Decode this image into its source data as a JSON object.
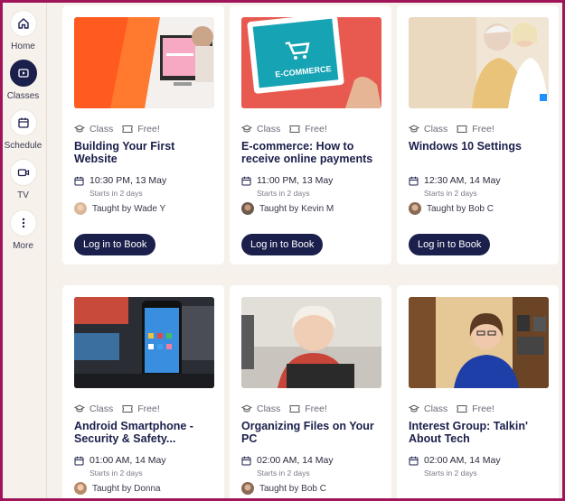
{
  "sidebar": {
    "items": [
      {
        "label": "Home",
        "icon": "home-icon",
        "active": false
      },
      {
        "label": "Classes",
        "icon": "play-icon",
        "active": true
      },
      {
        "label": "Schedule",
        "icon": "calendar-icon",
        "active": false
      },
      {
        "label": "TV",
        "icon": "video-camera-icon",
        "active": false
      },
      {
        "label": "More",
        "icon": "more-vertical-icon",
        "active": false
      }
    ]
  },
  "labels": {
    "class": "Class",
    "free": "Free!",
    "book": "Log in to Book",
    "starts": "Starts in 2 days"
  },
  "cards": [
    {
      "title": "Building Your First Website",
      "datetime": "10:30 PM, 13 May",
      "starts": "Starts in 2 days",
      "teacher": "Taught by Wade Y"
    },
    {
      "title": "E-commerce: How to receive online payments",
      "datetime": "11:00 PM, 13 May",
      "starts": "Starts in 2 days",
      "teacher": "Taught by Kevin M",
      "thumb_text": "E-COMMERCE"
    },
    {
      "title": "Windows 10 Settings",
      "datetime": "12:30 AM, 14 May",
      "starts": "Starts in 2 days",
      "teacher": "Taught by Bob C"
    },
    {
      "title": "Android Smartphone - Security & Safety...",
      "datetime": "01:00 AM, 14 May",
      "starts": "Starts in 2 days",
      "teacher": "Taught by Donna"
    },
    {
      "title": "Organizing Files on Your PC",
      "datetime": "02:00 AM, 14 May",
      "starts": "Starts in 2 days",
      "teacher": "Taught by Bob C"
    },
    {
      "title": "Interest Group: Talkin' About Tech",
      "datetime": "02:00 AM, 14 May",
      "starts": "Starts in 2 days",
      "teacher": ""
    }
  ],
  "colors": {
    "accent": "#1b1f4b",
    "background": "#f6f1ea",
    "border": "#a0145a"
  }
}
